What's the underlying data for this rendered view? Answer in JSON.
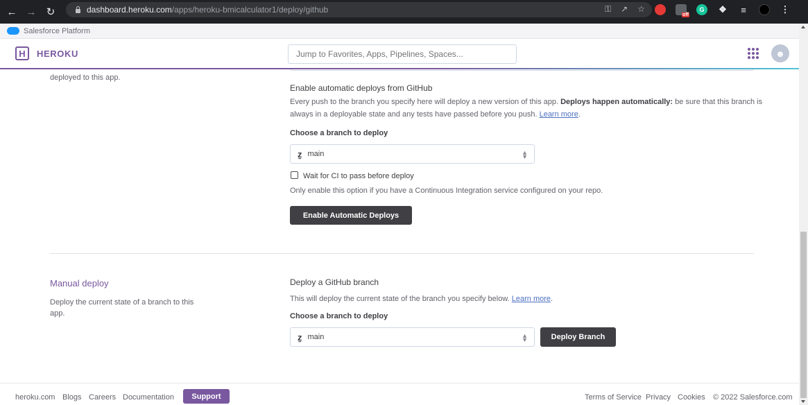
{
  "browser": {
    "url_domain": "dashboard.heroku.com",
    "url_path": "/apps/heroku-bmicalculator1/deploy/github",
    "ext_badge_off": "off"
  },
  "salesforce_bar": {
    "label": "Salesforce Platform"
  },
  "header": {
    "logo_letter": "H",
    "brand": "HEROKU",
    "search_placeholder": "Jump to Favorites, Apps, Pipelines, Spaces..."
  },
  "auto_deploy": {
    "side_text": "deployed to this app.",
    "heading": "Enable automatic deploys from GitHub",
    "desc_before": "Every push to the branch you specify here will deploy a new version of this app. ",
    "desc_bold": "Deploys happen automatically:",
    "desc_after": " be sure that this branch is always in a deployable state and any tests have passed before you push. ",
    "learn_more": "Learn more",
    "desc_end": ".",
    "choose_label": "Choose a branch to deploy",
    "branch": "main",
    "ci_label": "Wait for CI to pass before deploy",
    "ci_note": "Only enable this option if you have a Continuous Integration service configured on your repo.",
    "button": "Enable Automatic Deploys"
  },
  "manual_deploy": {
    "title": "Manual deploy",
    "side_text": "Deploy the current state of a branch to this app.",
    "heading": "Deploy a GitHub branch",
    "desc": "This will deploy the current state of the branch you specify below. ",
    "learn_more": "Learn more",
    "desc_end": ".",
    "choose_label": "Choose a branch to deploy",
    "branch": "main",
    "button": "Deploy Branch"
  },
  "footer": {
    "links_left": [
      "heroku.com",
      "Blogs",
      "Careers",
      "Documentation"
    ],
    "support": "Support",
    "links_right": [
      "Terms of Service",
      "Privacy",
      "Cookies"
    ],
    "copyright": "© 2022 Salesforce.com"
  },
  "colors": {
    "heroku_purple": "#79589f",
    "dark_button": "#3f3f44",
    "link": "#4b70c0"
  }
}
